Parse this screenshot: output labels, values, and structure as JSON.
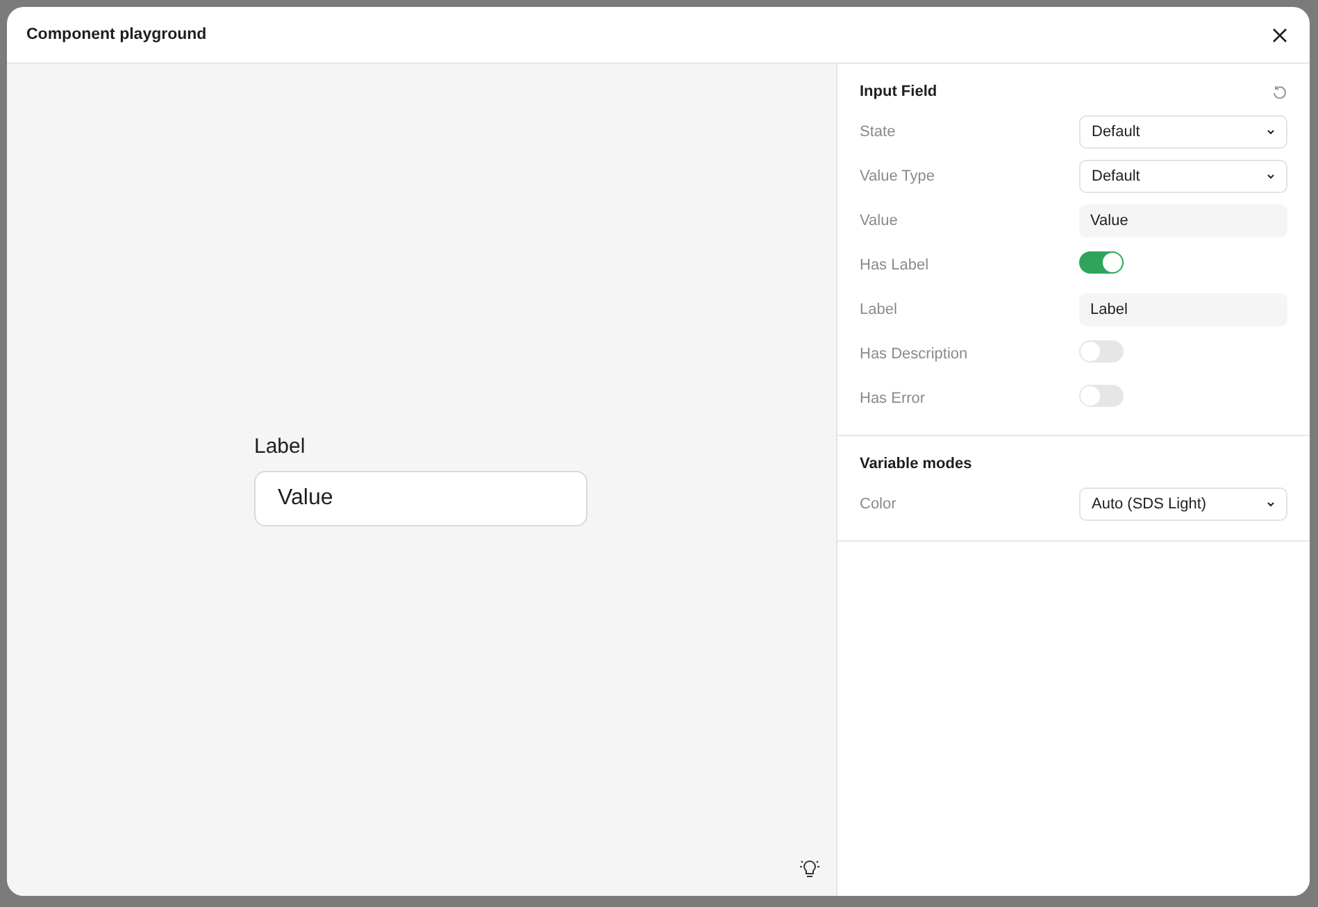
{
  "window": {
    "title": "Component playground"
  },
  "preview": {
    "label": "Label",
    "value": "Value"
  },
  "properties": {
    "title": "Input Field",
    "rows": [
      {
        "kind": "select",
        "label": "State",
        "value": "Default"
      },
      {
        "kind": "select",
        "label": "Value Type",
        "value": "Default"
      },
      {
        "kind": "text",
        "label": "Value",
        "value": "Value"
      },
      {
        "kind": "toggle",
        "label": "Has Label",
        "on": true
      },
      {
        "kind": "text",
        "label": "Label",
        "value": "Label"
      },
      {
        "kind": "toggle",
        "label": "Has Description",
        "on": false
      },
      {
        "kind": "toggle",
        "label": "Has Error",
        "on": false
      }
    ]
  },
  "variable_modes": {
    "title": "Variable modes",
    "rows": [
      {
        "kind": "select",
        "label": "Color",
        "value": "Auto (SDS Light)"
      }
    ]
  }
}
